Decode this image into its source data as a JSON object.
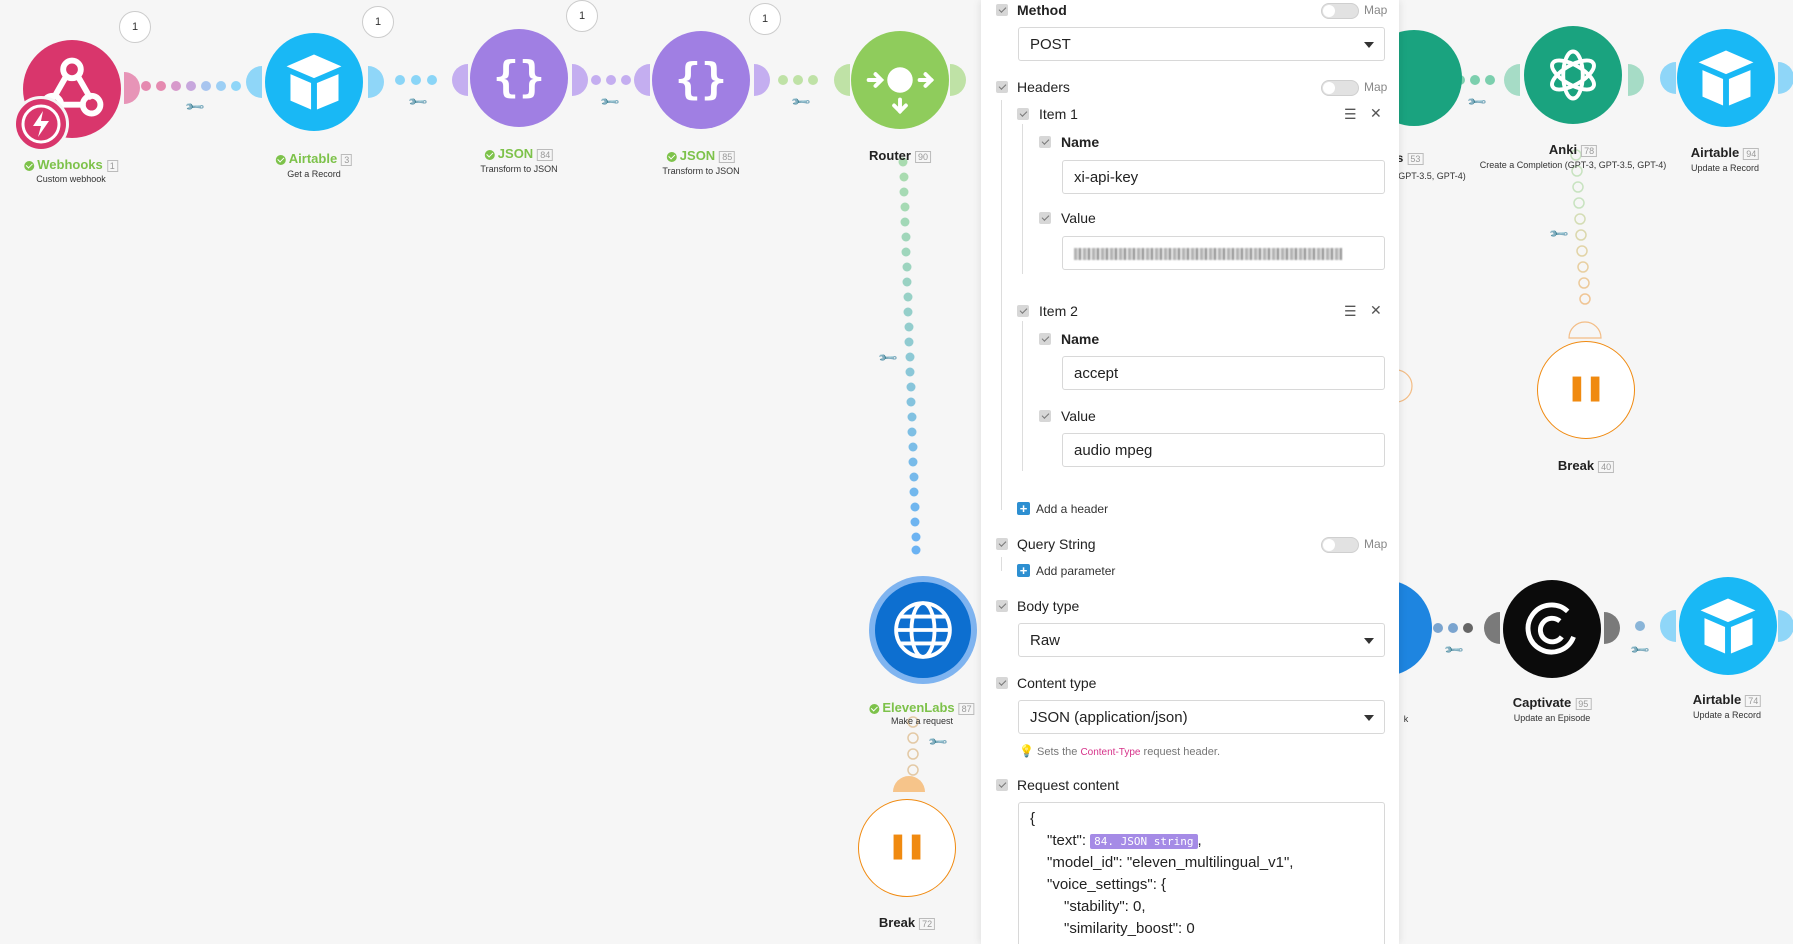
{
  "colors": {
    "webhooks": "#d9366c",
    "airtable": "#19b8f5",
    "json": "#a07fe3",
    "router": "#8fcc5c",
    "http": "#0d6fd0",
    "openai": "#1aa37f",
    "captivate": "#0b0b0b",
    "break": "#f08a10"
  },
  "modules": {
    "webhooks": {
      "name": "Webhooks",
      "num": "1",
      "sub": "Custom webhook",
      "bubble": "1",
      "icon": "webhook-icon"
    },
    "airtable_get": {
      "name": "Airtable",
      "num": "3",
      "sub": "Get a Record",
      "bubble": "1",
      "icon": "airtable-icon"
    },
    "json84": {
      "name": "JSON",
      "num": "84",
      "sub": "Transform to JSON",
      "bubble": "1",
      "icon": "braces-icon"
    },
    "json85": {
      "name": "JSON",
      "num": "85",
      "sub": "Transform to JSON",
      "bubble": "1",
      "icon": "braces-icon"
    },
    "router": {
      "name": "Router",
      "num": "90",
      "icon": "router-icon"
    },
    "elevenlabs": {
      "name": "ElevenLabs",
      "num": "87",
      "sub": "Make a request",
      "icon": "globe-icon"
    },
    "break72": {
      "name": "Break",
      "num": "72",
      "icon": "pause-icon"
    },
    "partial53": {
      "name": "s",
      "num": "53",
      "sub": "GPT-3.5, GPT-4)"
    },
    "anki": {
      "name": "Anki",
      "num": "78",
      "sub": "Create a Completion (GPT-3, GPT-3.5, GPT-4)",
      "icon": "openai-icon"
    },
    "airtable_update94": {
      "name": "Airtable",
      "num": "94",
      "sub": "Update a Record",
      "icon": "airtable-icon"
    },
    "break40": {
      "name": "Break",
      "num": "40",
      "icon": "pause-icon"
    },
    "partial_k": {
      "sub": "k"
    },
    "captivate": {
      "name": "Captivate",
      "num": "95",
      "sub": "Update an Episode",
      "icon": "captivate-icon"
    },
    "airtable_update74": {
      "name": "Airtable",
      "num": "74",
      "sub": "Update a Record",
      "icon": "airtable-icon"
    }
  },
  "panel": {
    "map_label": "Map",
    "method": {
      "label": "Method",
      "value": "POST"
    },
    "headers": {
      "label": "Headers",
      "items": [
        {
          "title": "Item 1",
          "name_label": "Name",
          "name_value": "xi-api-key",
          "value_label": "Value",
          "value_value": ""
        },
        {
          "title": "Item 2",
          "name_label": "Name",
          "name_value": "accept",
          "value_label": "Value",
          "value_value": "audio mpeg"
        }
      ],
      "add_label": "Add a header"
    },
    "query": {
      "label": "Query String",
      "add_label": "Add parameter"
    },
    "body_type": {
      "label": "Body type",
      "value": "Raw"
    },
    "content_type": {
      "label": "Content type",
      "value": "JSON (application/json)",
      "hint_pre": "Sets the",
      "hint_code": "Content-Type",
      "hint_post": "request header."
    },
    "request_content": {
      "label": "Request content",
      "line1": "{",
      "line2_pre": "\"text\": ",
      "pill": "84. JSON string",
      "line2_post": ",",
      "line3": "\"model_id\": \"eleven_multilingual_v1\",",
      "line4": "\"voice_settings\": {",
      "line5": "\"stability\": 0,",
      "line6": "\"similarity_boost\": 0"
    }
  }
}
